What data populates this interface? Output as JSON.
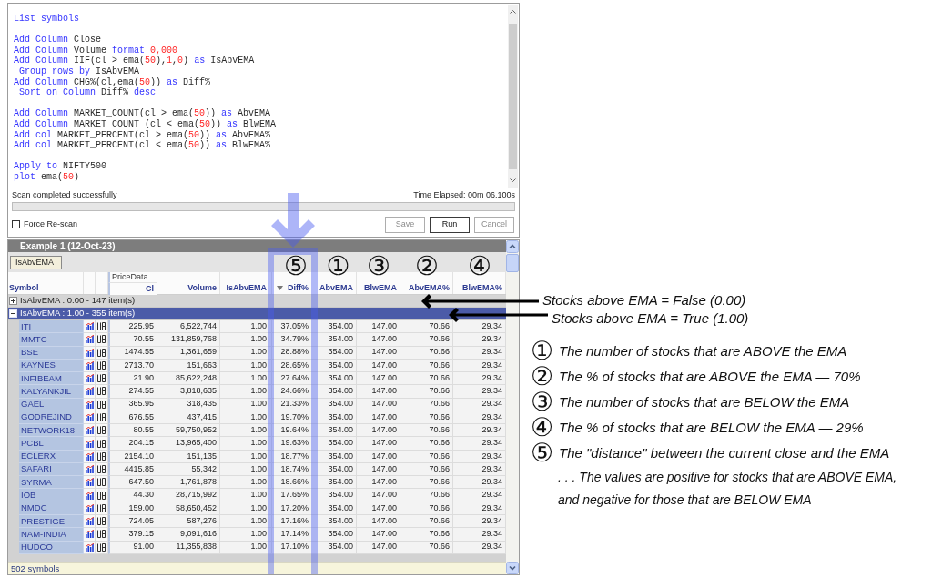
{
  "editor": {
    "blocks": [
      {
        "lines": [
          {
            "tokens": [
              {
                "text": "List symbols",
                "kind": "keyword"
              }
            ]
          }
        ]
      },
      {
        "lines": [
          {
            "tokens": [
              {
                "text": "Add Column",
                "kind": "keyword"
              },
              {
                "text": " Close",
                "kind": "plain"
              }
            ]
          },
          {
            "tokens": [
              {
                "text": "Add Column",
                "kind": "keyword"
              },
              {
                "text": " Volume ",
                "kind": "plain"
              },
              {
                "text": "format",
                "kind": "keyword"
              },
              {
                "text": " 0,000",
                "kind": "number"
              }
            ]
          },
          {
            "tokens": [
              {
                "text": "Add Column",
                "kind": "keyword"
              },
              {
                "text": " IIF(cl > ema(",
                "kind": "plain"
              },
              {
                "text": "50",
                "kind": "number"
              },
              {
                "text": "),",
                "kind": "plain"
              },
              {
                "text": "1",
                "kind": "number"
              },
              {
                "text": ",",
                "kind": "plain"
              },
              {
                "text": "0",
                "kind": "number"
              },
              {
                "text": ") ",
                "kind": "plain"
              },
              {
                "text": "as",
                "kind": "keyword"
              },
              {
                "text": " IsAbvEMA",
                "kind": "plain"
              }
            ]
          },
          {
            "tokens": [
              {
                "text": " Group rows by",
                "kind": "keyword"
              },
              {
                "text": " IsAbvEMA",
                "kind": "plain"
              }
            ]
          },
          {
            "tokens": [
              {
                "text": "Add Column",
                "kind": "keyword"
              },
              {
                "text": " CHG%(cl,ema(",
                "kind": "plain"
              },
              {
                "text": "50",
                "kind": "number"
              },
              {
                "text": ")) ",
                "kind": "plain"
              },
              {
                "text": "as",
                "kind": "keyword"
              },
              {
                "text": " Diff%",
                "kind": "plain"
              }
            ]
          },
          {
            "tokens": [
              {
                "text": " Sort on Column",
                "kind": "keyword"
              },
              {
                "text": " Diff% ",
                "kind": "plain"
              },
              {
                "text": "desc",
                "kind": "keyword"
              }
            ]
          }
        ]
      },
      {
        "lines": [
          {
            "tokens": [
              {
                "text": "Add Column",
                "kind": "keyword"
              },
              {
                "text": " MARKET_COUNT(cl > ema(",
                "kind": "plain"
              },
              {
                "text": "50",
                "kind": "number"
              },
              {
                "text": ")) ",
                "kind": "plain"
              },
              {
                "text": "as",
                "kind": "keyword"
              },
              {
                "text": " AbvEMA",
                "kind": "plain"
              }
            ]
          },
          {
            "tokens": [
              {
                "text": "Add Column",
                "kind": "keyword"
              },
              {
                "text": " MARKET_COUNT (cl < ema(",
                "kind": "plain"
              },
              {
                "text": "50",
                "kind": "number"
              },
              {
                "text": ")) ",
                "kind": "plain"
              },
              {
                "text": "as",
                "kind": "keyword"
              },
              {
                "text": " BlwEMA",
                "kind": "plain"
              }
            ]
          },
          {
            "tokens": [
              {
                "text": "Add col",
                "kind": "keyword"
              },
              {
                "text": " MARKET_PERCENT(cl > ema(",
                "kind": "plain"
              },
              {
                "text": "50",
                "kind": "number"
              },
              {
                "text": ")) ",
                "kind": "plain"
              },
              {
                "text": "as",
                "kind": "keyword"
              },
              {
                "text": " AbvEMA%",
                "kind": "plain"
              }
            ]
          },
          {
            "tokens": [
              {
                "text": "Add col",
                "kind": "keyword"
              },
              {
                "text": " MARKET_PERCENT(cl < ema(",
                "kind": "plain"
              },
              {
                "text": "50",
                "kind": "number"
              },
              {
                "text": ")) ",
                "kind": "plain"
              },
              {
                "text": "as",
                "kind": "keyword"
              },
              {
                "text": " BlwEMA%",
                "kind": "plain"
              }
            ]
          }
        ]
      },
      {
        "lines": [
          {
            "tokens": [
              {
                "text": "Apply to",
                "kind": "keyword"
              },
              {
                "text": " NIFTY500",
                "kind": "plain"
              }
            ]
          },
          {
            "tokens": [
              {
                "text": "plot",
                "kind": "keyword"
              },
              {
                "text": " ema(",
                "kind": "plain"
              },
              {
                "text": "50",
                "kind": "number"
              },
              {
                "text": ")",
                "kind": "plain"
              }
            ]
          }
        ]
      }
    ]
  },
  "status": {
    "message": "Scan completed successfully",
    "elapsed": "Time Elapsed: 00m 06.100s"
  },
  "force_rescan": {
    "label": "Force Re-scan",
    "checked": false
  },
  "buttons": [
    {
      "label": "Save",
      "disabled": true
    },
    {
      "label": "Run",
      "disabled": false
    },
    {
      "label": "Cancel",
      "disabled": true
    }
  ],
  "results": {
    "title": "Example 1 (12-Oct-23)",
    "group_by": [
      {
        "label": "IsAbvEMA"
      }
    ],
    "columns": [
      {
        "kind": "text",
        "label": "Symbol"
      },
      {
        "kind": "chart"
      },
      {
        "kind": "script"
      },
      {
        "kind": "number",
        "label": "Cl",
        "group_label": "PriceData"
      },
      {
        "kind": "number",
        "label": "Volume"
      },
      {
        "kind": "number",
        "label": "IsAbvEMA"
      },
      {
        "kind": "number",
        "label": "Diff%",
        "sorted": true,
        "marker": "⑤"
      },
      {
        "kind": "number",
        "label": "AbvEMA",
        "marker": "①"
      },
      {
        "kind": "number",
        "label": "BlwEMA",
        "marker": "③"
      },
      {
        "kind": "number",
        "label": "AbvEMA%",
        "marker": "②"
      },
      {
        "kind": "number",
        "label": "BlwEMA%",
        "marker": "④"
      }
    ],
    "groups": [
      {
        "label": "IsAbvEMA : 0.00 - 147 item(s)",
        "expanded": false,
        "selected": false
      },
      {
        "label": "IsAbvEMA : 1.00 - 355 item(s)",
        "expanded": true,
        "selected": true,
        "rows": [
          {
            "cells": [
              "ITI",
              "225.95",
              "6,522,744",
              "1.00",
              "37.05%",
              "354.00",
              "147.00",
              "70.66",
              "29.34"
            ]
          },
          {
            "cells": [
              "MMTC",
              "70.55",
              "131,859,768",
              "1.00",
              "34.79%",
              "354.00",
              "147.00",
              "70.66",
              "29.34"
            ]
          },
          {
            "cells": [
              "BSE",
              "1474.55",
              "1,361,659",
              "1.00",
              "28.88%",
              "354.00",
              "147.00",
              "70.66",
              "29.34"
            ]
          },
          {
            "cells": [
              "KAYNES",
              "2713.70",
              "151,663",
              "1.00",
              "28.65%",
              "354.00",
              "147.00",
              "70.66",
              "29.34"
            ]
          },
          {
            "cells": [
              "INFIBEAM",
              "21.90",
              "85,622,248",
              "1.00",
              "27.64%",
              "354.00",
              "147.00",
              "70.66",
              "29.34"
            ]
          },
          {
            "cells": [
              "KALYANKJIL",
              "274.55",
              "3,818,635",
              "1.00",
              "24.66%",
              "354.00",
              "147.00",
              "70.66",
              "29.34"
            ]
          },
          {
            "cells": [
              "GAEL",
              "365.95",
              "318,435",
              "1.00",
              "21.33%",
              "354.00",
              "147.00",
              "70.66",
              "29.34"
            ]
          },
          {
            "cells": [
              "GODREJIND",
              "676.55",
              "437,415",
              "1.00",
              "19.70%",
              "354.00",
              "147.00",
              "70.66",
              "29.34"
            ]
          },
          {
            "cells": [
              "NETWORK18",
              "80.55",
              "59,750,952",
              "1.00",
              "19.64%",
              "354.00",
              "147.00",
              "70.66",
              "29.34"
            ]
          },
          {
            "cells": [
              "PCBL",
              "204.15",
              "13,965,400",
              "1.00",
              "19.63%",
              "354.00",
              "147.00",
              "70.66",
              "29.34"
            ]
          },
          {
            "cells": [
              "ECLERX",
              "2154.10",
              "151,135",
              "1.00",
              "18.77%",
              "354.00",
              "147.00",
              "70.66",
              "29.34"
            ]
          },
          {
            "cells": [
              "SAFARI",
              "4415.85",
              "55,342",
              "1.00",
              "18.74%",
              "354.00",
              "147.00",
              "70.66",
              "29.34"
            ]
          },
          {
            "cells": [
              "SYRMA",
              "647.50",
              "1,761,878",
              "1.00",
              "18.66%",
              "354.00",
              "147.00",
              "70.66",
              "29.34"
            ]
          },
          {
            "cells": [
              "IOB",
              "44.30",
              "28,715,992",
              "1.00",
              "17.65%",
              "354.00",
              "147.00",
              "70.66",
              "29.34"
            ]
          },
          {
            "cells": [
              "NMDC",
              "159.00",
              "58,650,452",
              "1.00",
              "17.20%",
              "354.00",
              "147.00",
              "70.66",
              "29.34"
            ]
          },
          {
            "cells": [
              "PRESTIGE",
              "724.05",
              "587,276",
              "1.00",
              "17.16%",
              "354.00",
              "147.00",
              "70.66",
              "29.34"
            ]
          },
          {
            "cells": [
              "NAM-INDIA",
              "379.15",
              "9,091,616",
              "1.00",
              "17.14%",
              "354.00",
              "147.00",
              "70.66",
              "29.34"
            ]
          },
          {
            "cells": [
              "HUDCO",
              "91.00",
              "11,355,838",
              "1.00",
              "17.10%",
              "354.00",
              "147.00",
              "70.66",
              "29.34"
            ]
          }
        ]
      }
    ],
    "footer": "502 symbols"
  },
  "annotations": {
    "callouts": [
      {
        "text": "Stocks above EMA = False (0.00)"
      },
      {
        "text": "Stocks above EMA = True (1.00)"
      }
    ],
    "legend": [
      {
        "marker": "①",
        "text": "The number of stocks that are ABOVE the EMA"
      },
      {
        "marker": "②",
        "text": "The % of stocks that are ABOVE the EMA — 70%"
      },
      {
        "marker": "③",
        "text": "The number of stocks that are BELOW the EMA"
      },
      {
        "marker": "④",
        "text": "The % of stocks that are BELOW the EMA — 29%"
      },
      {
        "marker": "⑤",
        "text": "The \"distance\" between the current close and the EMA",
        "notes": [
          ". . . The values are positive for stocks that are ABOVE EMA,",
          "and negative for those that are BELOW EMA"
        ]
      }
    ]
  }
}
